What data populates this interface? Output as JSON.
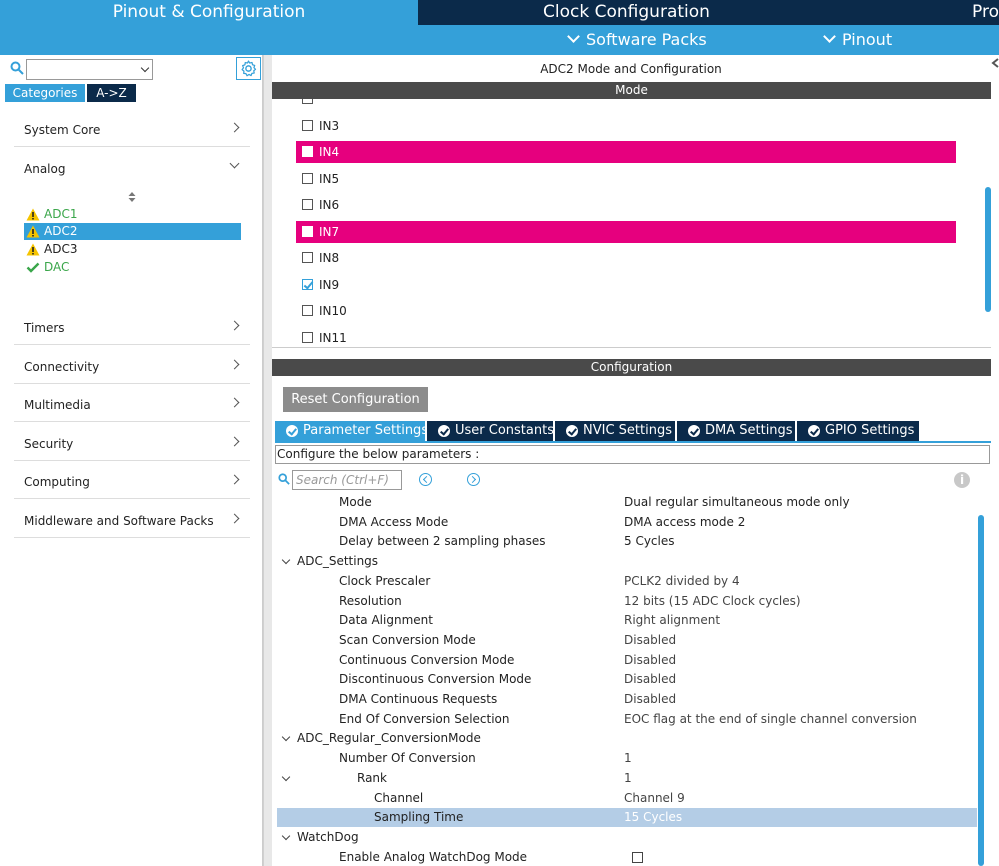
{
  "top_tabs": {
    "pinout": "Pinout & Configuration",
    "clock": "Clock Configuration",
    "project": "Pro"
  },
  "sub_menu": {
    "software_packs": "Software Packs",
    "pinout": "Pinout"
  },
  "left_panel": {
    "search_value": "",
    "tab_categories": "Categories",
    "tab_az": "A->Z",
    "categories": [
      {
        "label": "System Core",
        "expanded": false
      },
      {
        "label": "Analog",
        "expanded": true
      },
      {
        "label": "Timers",
        "expanded": false
      },
      {
        "label": "Connectivity",
        "expanded": false
      },
      {
        "label": "Multimedia",
        "expanded": false
      },
      {
        "label": "Security",
        "expanded": false
      },
      {
        "label": "Computing",
        "expanded": false
      },
      {
        "label": "Middleware and Software Packs",
        "expanded": false
      }
    ],
    "analog_items": [
      {
        "label": "ADC1",
        "status": "warning",
        "selected": false
      },
      {
        "label": "ADC2",
        "status": "warning",
        "selected": true
      },
      {
        "label": "ADC3",
        "status": "warning",
        "selected": false
      },
      {
        "label": "DAC",
        "status": "ok",
        "selected": false
      }
    ]
  },
  "mode_panel": {
    "title": "ADC2 Mode and Configuration",
    "header": "Mode",
    "channels": [
      {
        "label": "IN3",
        "checked": false,
        "highlighted": false
      },
      {
        "label": "IN4",
        "checked": false,
        "highlighted": true
      },
      {
        "label": "IN5",
        "checked": false,
        "highlighted": false
      },
      {
        "label": "IN6",
        "checked": false,
        "highlighted": false
      },
      {
        "label": "IN7",
        "checked": false,
        "highlighted": true
      },
      {
        "label": "IN8",
        "checked": false,
        "highlighted": false
      },
      {
        "label": "IN9",
        "checked": true,
        "highlighted": false
      },
      {
        "label": "IN10",
        "checked": false,
        "highlighted": false
      },
      {
        "label": "IN11",
        "checked": false,
        "highlighted": false
      }
    ]
  },
  "config_panel": {
    "header": "Configuration",
    "reset_button": "Reset Configuration",
    "tabs": [
      {
        "label": "Parameter Settings",
        "active": true
      },
      {
        "label": "User Constants",
        "active": false
      },
      {
        "label": "NVIC Settings",
        "active": false
      },
      {
        "label": "DMA Settings",
        "active": false
      },
      {
        "label": "GPIO Settings",
        "active": false
      }
    ],
    "configure_label": "Configure the below parameters :",
    "search_placeholder": "Search (Ctrl+F)",
    "params": [
      {
        "key": "Mode",
        "value": "Dual regular simultaneous mode only",
        "level": 2
      },
      {
        "key": "DMA Access Mode",
        "value": "DMA access mode 2",
        "level": 2
      },
      {
        "key": "Delay between 2 sampling phases",
        "value": "5 Cycles",
        "level": 2
      },
      {
        "key": "ADC_Settings",
        "value": "",
        "level": 1,
        "group": true
      },
      {
        "key": "Clock Prescaler",
        "value": "PCLK2 divided by 4",
        "level": 2
      },
      {
        "key": "Resolution",
        "value": "12 bits (15 ADC Clock cycles)",
        "level": 2
      },
      {
        "key": "Data Alignment",
        "value": "Right alignment",
        "level": 2
      },
      {
        "key": "Scan Conversion Mode",
        "value": "Disabled",
        "level": 2
      },
      {
        "key": "Continuous Conversion Mode",
        "value": "Disabled",
        "level": 2
      },
      {
        "key": "Discontinuous Conversion Mode",
        "value": "Disabled",
        "level": 2
      },
      {
        "key": "DMA Continuous Requests",
        "value": "Disabled",
        "level": 2
      },
      {
        "key": "End Of Conversion Selection",
        "value": "EOC flag at the end of single channel conversion",
        "level": 2
      },
      {
        "key": "ADC_Regular_ConversionMode",
        "value": "",
        "level": 1,
        "group": true
      },
      {
        "key": "Number Of Conversion",
        "value": "1",
        "level": 2
      },
      {
        "key": "Rank",
        "value": "1",
        "level": 3,
        "group": true
      },
      {
        "key": "Channel",
        "value": "Channel 9",
        "level": 4
      },
      {
        "key": "Sampling Time",
        "value": "15 Cycles",
        "level": 4,
        "selected": true
      },
      {
        "key": "WatchDog",
        "value": "",
        "level": 1,
        "group": true
      },
      {
        "key": "Enable Analog WatchDog Mode",
        "value": "",
        "level": 2,
        "checkbox": true
      }
    ]
  },
  "colors": {
    "accent": "#34a0d9",
    "dark": "#0b2a4a",
    "highlight_pin": "#e6007e",
    "warning": "#f5c400",
    "ok": "#3aa64a"
  }
}
